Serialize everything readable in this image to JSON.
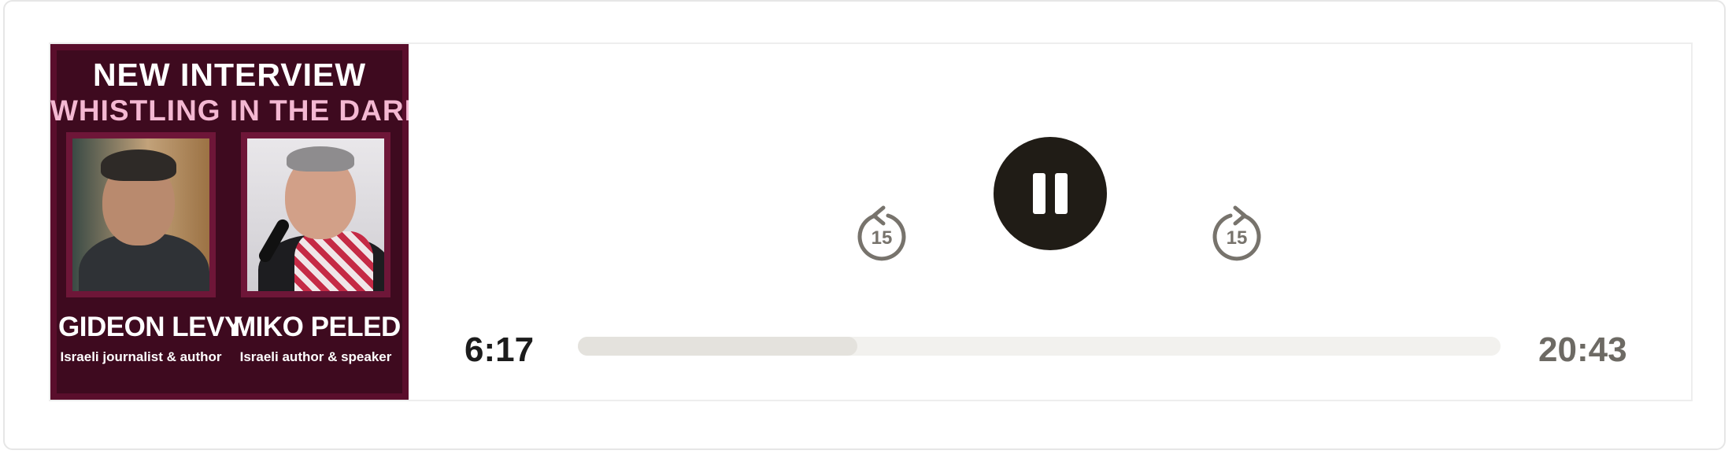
{
  "cover": {
    "headline": "NEW INTERVIEW",
    "subheadline": "WHISTLING IN THE DARK",
    "guests": [
      {
        "name": "GIDEON LEVY",
        "role": "Israeli journalist & author"
      },
      {
        "name": "MIKO PELED",
        "role": "Israeli author & speaker"
      }
    ]
  },
  "controls": {
    "skip_back_seconds": "15",
    "skip_forward_seconds": "15",
    "play_state_icon": "pause-icon"
  },
  "progress": {
    "elapsed": "6:17",
    "total": "20:43",
    "fraction": 0.303
  },
  "colors": {
    "cover_bg": "#5a0e2c",
    "subheadline": "#f4b8d2",
    "play_button": "#201c16",
    "icon_gray": "#77736c",
    "track": "#f2f1ee",
    "track_fill": "#e4e2dd"
  }
}
